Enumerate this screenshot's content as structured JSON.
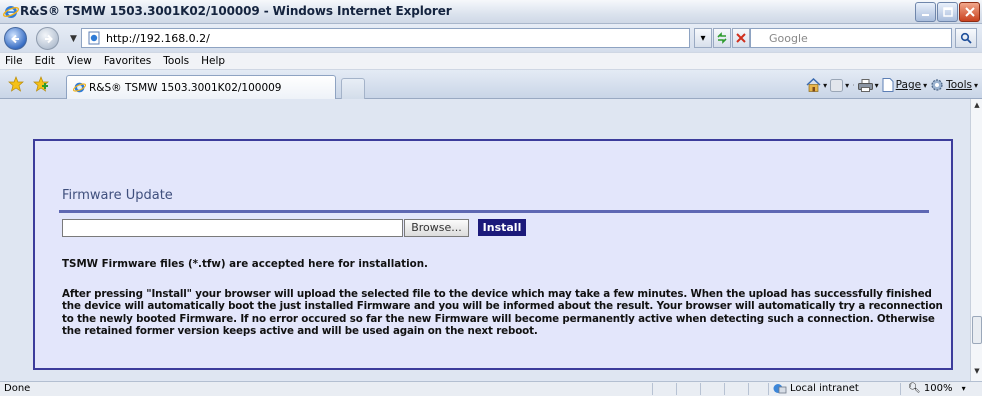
{
  "window": {
    "title": "R&S® TSMW 1503.3001K02/100009 - Windows Internet Explorer"
  },
  "address_bar": {
    "url": "http://192.168.0.2/",
    "search_placeholder": "Google"
  },
  "menu": {
    "items": [
      "File",
      "Edit",
      "View",
      "Favorites",
      "Tools",
      "Help"
    ]
  },
  "tabs": {
    "active_title": "R&S® TSMW 1503.3001K02/100009"
  },
  "command_bar": {
    "page_label": "Page",
    "tools_label": "Tools"
  },
  "content": {
    "section_title": "Firmware Update",
    "browse_label": "Browse...",
    "install_label": "Install",
    "accepted_text": "TSMW Firmware files (*.tfw) are accepted here for installation.",
    "description": "After pressing \"Install\" your browser will upload the selected file to the device which may take a few minutes. When the upload has successfully finished the device will automatically boot the just installed Firmware and you will be informed about the result. Your browser will automatically try a reconnection to the newly booted Firmware. If no error occured so far the new Firmware will become permanently active when detecting such a connection. Otherwise the retained former version keeps active and will be used again on the next reboot."
  },
  "status_bar": {
    "status": "Done",
    "zone": "Local intranet",
    "zoom": "100%"
  }
}
